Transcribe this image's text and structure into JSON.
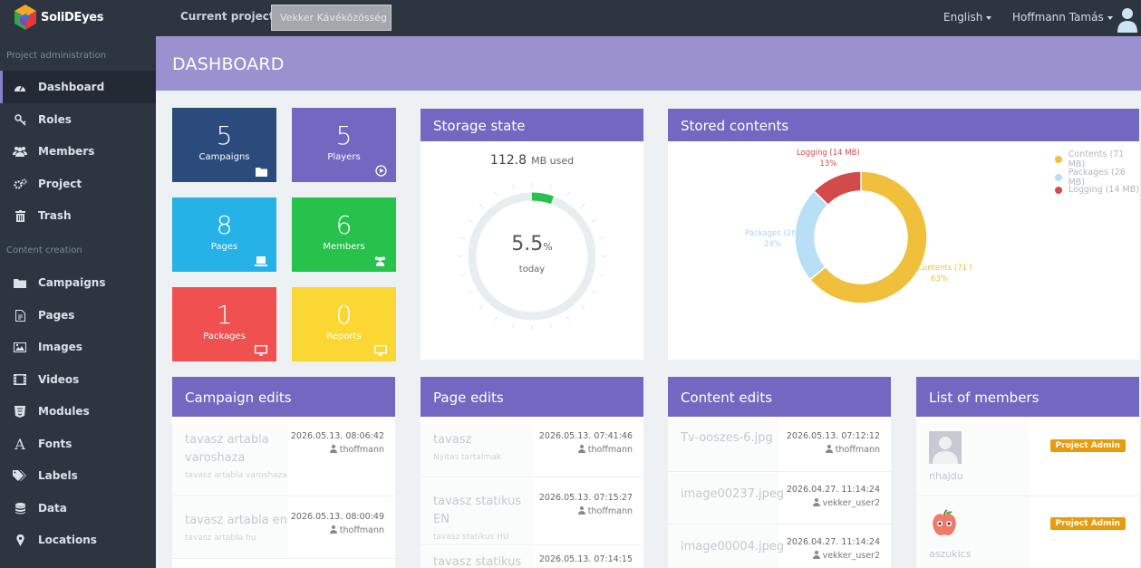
{
  "topbar": {
    "logo_text": "SoliDEyes",
    "current_project_label": "Current project",
    "project_select_value": "Vekker Kávéközösség",
    "language": "English",
    "user_name": "Hoffmann Tamás"
  },
  "sidebar": {
    "section_admin": "Project administration",
    "section_content": "Content creation",
    "admin_items": [
      {
        "label": "Dashboard",
        "icon": "dashboard-icon"
      },
      {
        "label": "Roles",
        "icon": "key-icon"
      },
      {
        "label": "Members",
        "icon": "users-icon"
      },
      {
        "label": "Project",
        "icon": "cogs-icon"
      },
      {
        "label": "Trash",
        "icon": "trash-icon"
      }
    ],
    "content_items": [
      {
        "label": "Campaigns",
        "icon": "folder-icon"
      },
      {
        "label": "Pages",
        "icon": "file-icon"
      },
      {
        "label": "Images",
        "icon": "image-icon"
      },
      {
        "label": "Videos",
        "icon": "film-icon"
      },
      {
        "label": "Modules",
        "icon": "html5-icon"
      },
      {
        "label": "Fonts",
        "icon": "font-icon"
      },
      {
        "label": "Labels",
        "icon": "tags-icon"
      },
      {
        "label": "Data",
        "icon": "database-icon"
      },
      {
        "label": "Locations",
        "icon": "map-marker-icon"
      }
    ]
  },
  "header": {
    "title": "DASHBOARD"
  },
  "tiles": [
    {
      "value": "5",
      "label": "Campaigns",
      "color": "#2a4b7c"
    },
    {
      "value": "5",
      "label": "Players",
      "color": "#7467c1"
    },
    {
      "value": "8",
      "label": "Pages",
      "color": "#25b2e6"
    },
    {
      "value": "6",
      "label": "Members",
      "color": "#27c24c"
    },
    {
      "value": "1",
      "label": "Packages",
      "color": "#f05050"
    },
    {
      "value": "0",
      "label": "Reports",
      "color": "#fad733"
    }
  ],
  "storage": {
    "title": "Storage state",
    "used_value": "112.8",
    "used_unit": "MB used",
    "percent_value": "5.5",
    "percent_unit": "%",
    "percent_fraction": 0.055,
    "caption": "today",
    "gauge_color": "#27c24c"
  },
  "stored_contents": {
    "title": "Stored contents",
    "chart_data": {
      "type": "pie",
      "title": "Stored contents",
      "categories": [
        "Contents (71 MB)",
        "Packages (26 MB)",
        "Logging (14 MB)"
      ],
      "values": [
        71,
        26,
        14
      ],
      "percent_labels": [
        "63%",
        "24%",
        "13%"
      ],
      "colors": [
        "#f0c03c",
        "#b9dff6",
        "#d24a4a"
      ],
      "legend_position": "top-right"
    }
  },
  "campaign_edits": {
    "title": "Campaign edits",
    "rows": [
      {
        "title": "tavasz artabla varoshaza",
        "sub": "tavasz artabla varoshaza",
        "date": "2026.05.13. 08:06:42",
        "user": "thoffmann"
      },
      {
        "title": "tavasz artabla en",
        "sub": "tavasz artabla hu",
        "date": "2026.05.13. 08:00:49",
        "user": "thoffmann"
      }
    ]
  },
  "page_edits": {
    "title": "Page edits",
    "rows": [
      {
        "title": "tavasz",
        "sub": "Nyitas tartalmak",
        "date": "2026.05.13. 07:41:46",
        "user": "thoffmann"
      },
      {
        "title": "tavasz statikus EN",
        "sub": "tavasz statikus HU",
        "date": "2026.05.13. 07:15:27",
        "user": "thoffmann"
      },
      {
        "title": "tavasz statikus HU",
        "sub": "",
        "date": "2026.05.13. 07:14:15",
        "user": ""
      }
    ]
  },
  "content_edits": {
    "title": "Content edits",
    "rows": [
      {
        "title": "Tv-ooszes-6.jpg",
        "date": "2026.05.13. 07:12:12",
        "user": "thoffmann"
      },
      {
        "title": "image00237.jpeg",
        "date": "2026.04.27. 11:14:24",
        "user": "vekker_user2"
      },
      {
        "title": "image00004.jpeg",
        "date": "2026.04.27. 11:14:24",
        "user": "vekker_user2"
      }
    ]
  },
  "members": {
    "title": "List of members",
    "rows": [
      {
        "name": "nhajdu",
        "role": "Project Admin",
        "avatar": "default-avatar-icon"
      },
      {
        "name": "aszukics",
        "role": "Project Admin",
        "avatar": "apple-avatar-icon"
      }
    ]
  }
}
